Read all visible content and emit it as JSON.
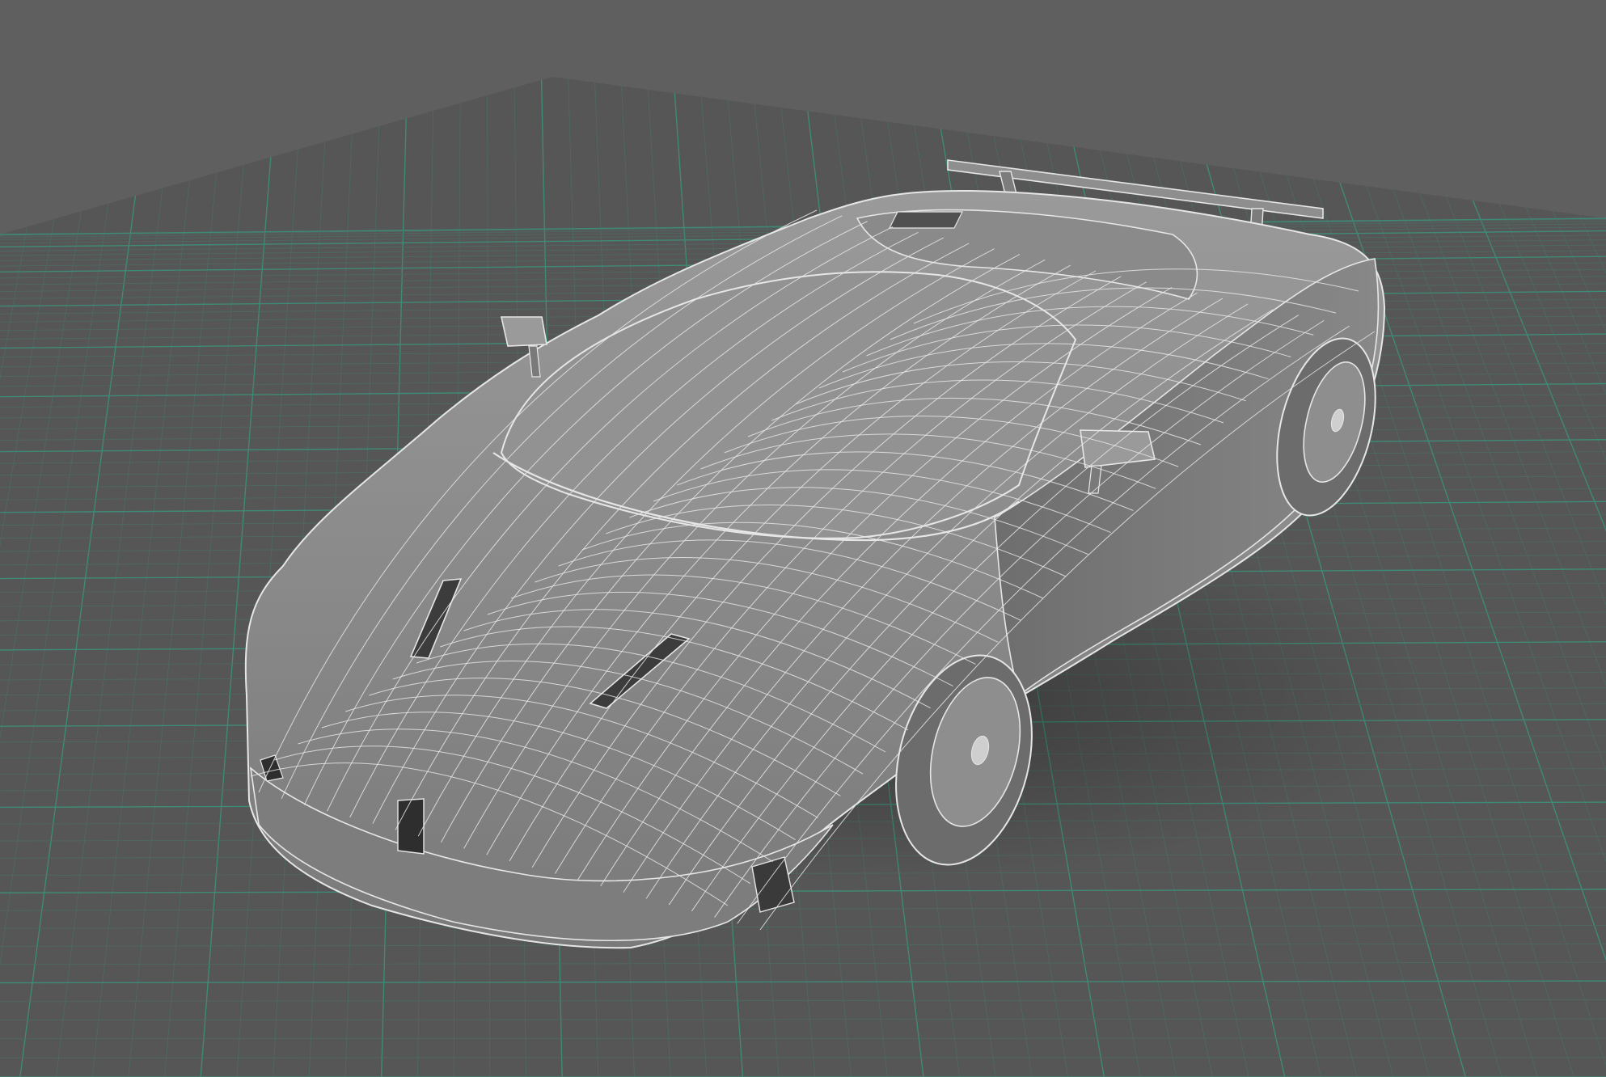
{
  "viewport": {
    "background_color": "#5f5f5f",
    "grid_major_color": "#3f8a76",
    "grid_minor_color": "#4d6b63",
    "ground_color": "#555555",
    "model": {
      "name": "sports-car",
      "display_mode": "wireframe-on-shaded",
      "surface_color": "#8b8b8b",
      "surface_light_color": "#a4a4a4",
      "surface_dark_color": "#6a6a6a",
      "wire_color": "#e6e6e6",
      "recess_color": "#3c3c3c"
    }
  }
}
